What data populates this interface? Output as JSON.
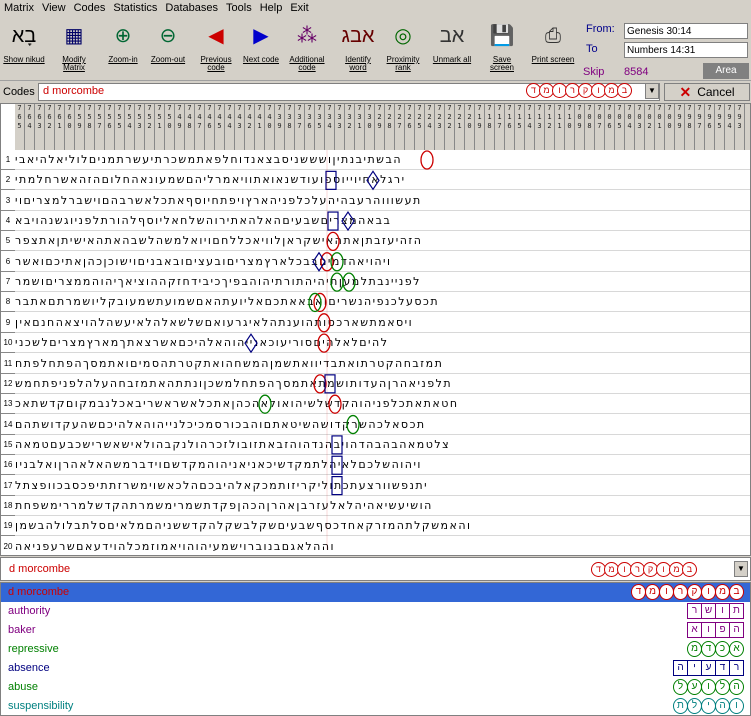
{
  "menu": [
    "Matrix",
    "View",
    "Codes",
    "Statistics",
    "Databases",
    "Tools",
    "Help",
    "Exit"
  ],
  "toolbar": [
    {
      "label": "Show nikud",
      "icon": "nikud-icon"
    },
    {
      "label": "Modify Matrix",
      "icon": "modify-matrix-icon"
    },
    {
      "label": "Zoom-in",
      "icon": "zoom-in-icon"
    },
    {
      "label": "Zoom-out",
      "icon": "zoom-out-icon"
    },
    {
      "label": "Previous code",
      "icon": "previous-code-icon"
    },
    {
      "label": "Next code",
      "icon": "next-code-icon"
    },
    {
      "label": "Additional code",
      "icon": "additional-code-icon"
    },
    {
      "label": "Identify word",
      "icon": "identify-word-icon"
    },
    {
      "label": "Proximity rank",
      "icon": "proximity-rank-icon"
    },
    {
      "label": "Unmark all",
      "icon": "unmark-all-icon"
    },
    {
      "label": "Save screen",
      "icon": "save-screen-icon"
    },
    {
      "label": "Print screen",
      "icon": "print-screen-icon"
    }
  ],
  "range": {
    "from_label": "From:",
    "from_value": "Genesis 30:14",
    "to_label": "To",
    "to_value": "Numbers 14:31"
  },
  "skip": {
    "label": "Skip",
    "value": "8584"
  },
  "area_label": "Area",
  "codes": {
    "label": "Codes :",
    "value": "d morcombe",
    "hebrew": [
      "ד",
      "מ",
      "ו",
      "ר",
      "ק",
      "ו",
      "מ",
      "ב"
    ]
  },
  "cancel_label": "Cancel",
  "column_numbers": [
    "7",
    "7",
    "7",
    "7",
    "7",
    "7",
    "7",
    "7",
    "7",
    "7",
    "7",
    "7",
    "7",
    "7",
    "7",
    "7",
    "7",
    "7",
    "7",
    "7",
    "7",
    "7",
    "7",
    "7",
    "7",
    "7",
    "7",
    "7",
    "7",
    "7",
    "7",
    "7",
    "7",
    "7",
    "7",
    "7",
    "7",
    "7",
    "7",
    "7",
    "7",
    "7",
    "7",
    "7",
    "7",
    "7",
    "7",
    "7",
    "7",
    "7",
    "7",
    "7",
    "7",
    "7",
    "7",
    "7",
    "7",
    "7",
    "7",
    "7",
    "7",
    "7",
    "7",
    "7",
    "7",
    "7",
    "7",
    "7",
    "7",
    "7",
    "7",
    "7",
    "7"
  ],
  "column_digits2": [
    "6",
    "6",
    "6",
    "6",
    "6",
    "6",
    "5",
    "5",
    "5",
    "5",
    "5",
    "5",
    "5",
    "5",
    "5",
    "5",
    "4",
    "4",
    "4",
    "4",
    "4",
    "4",
    "4",
    "4",
    "4",
    "4",
    "3",
    "3",
    "3",
    "3",
    "3",
    "3",
    "3",
    "3",
    "3",
    "3",
    "2",
    "2",
    "2",
    "2",
    "2",
    "2",
    "2",
    "2",
    "2",
    "2",
    "1",
    "1",
    "1",
    "1",
    "1",
    "1",
    "1",
    "1",
    "1",
    "1",
    "0",
    "0",
    "0",
    "0",
    "0",
    "0",
    "0",
    "0",
    "0",
    "0",
    "9",
    "9",
    "9",
    "9",
    "9",
    "9",
    "9"
  ],
  "column_digits3": [
    "5",
    "4",
    "3",
    "2",
    "1",
    "0",
    "9",
    "8",
    "7",
    "6",
    "5",
    "4",
    "3",
    "2",
    "1",
    "0",
    "9",
    "8",
    "7",
    "6",
    "5",
    "4",
    "3",
    "2",
    "1",
    "0",
    "9",
    "8",
    "7",
    "6",
    "5",
    "4",
    "3",
    "2",
    "1",
    "0",
    "9",
    "8",
    "7",
    "6",
    "5",
    "4",
    "3",
    "2",
    "1",
    "0",
    "9",
    "8",
    "7",
    "6",
    "5",
    "4",
    "3",
    "2",
    "1",
    "0",
    "9",
    "8",
    "7",
    "6",
    "5",
    "4",
    "3",
    "2",
    "1",
    "0",
    "9",
    "8",
    "7",
    "6",
    "5",
    "4",
    "3"
  ],
  "row_numbers": [
    "1",
    "2",
    "3",
    "4",
    "5",
    "6",
    "7",
    "8",
    "9",
    "10",
    "11",
    "12",
    "13",
    "14",
    "15",
    "16",
    "17",
    "18",
    "19",
    "20"
  ],
  "grid_rows": [
    "הבשתיבנתיןושששניסבצאנדוחלפאתמשכרתיעשרתמניםלוליאלהיאבי",
    "ירגלאחיוייוספועודשנאואתוויאמרליהםשמעונאהחלוםהזהאשרחלמתי",
    "תעשוווהרעבהיהעלכלפניהארץויפתחיוסףאתכלאשרבהםוישברלמצריםוי",
    "בבאהמצריםשבעיםהאלהאתירוהשלחאליוסףלהורתלפניוגשנהויבא",
    "הזהיעזבתןאתהאישקראןלוויאכללחםויואלמשהלשבהאתהאישיתןאתצפר",
    "ויהויאהדמיםבבכלארץמצריםובעציםובאבניםוישוכןכהןאתיכםואשר",
    "לפניינבתלמעןתיהיהתורתיהוהבפיךכיבידחזקההוציאךיהוהממצריםושמר",
    "תכסעלכנפיהנשריםואבאאתכםאליועתהאםשמועתשמעובקליושמרתםאתבר",
    "ויסאמתשארכסותהוענתהלאיגרעואםשלשאלהלאיעשהלהויצאהחנםאין",
    "להיםלאלהיםסוריעוכאנייהוהאלהיכםאשרצאתךמארץמצריםלשכני",
    "תמזבחהקטרתואתבדיוואתשמןהמשחהואתקטרתהסמיםואתמסךהפתחלפתח",
    "תלפניאהרןהעדותושמתאתמסךהפתחלמשכןונתתהאתמזבחהעלהלפניפתחמש",
    "חטאתאתכלפניהוהקדשלשיהואולאהכהןאתכלאשראשריבאכלנבמקוםקדשתאכ",
    "תכסאלכהשרקדושהשיטאתםוהבכורסמכיכלנייהוהאלהיכםשהעקדושתהם",
    "צלטמאהבהבהדהויבהנדהוהזבאתזובולזכרהולנקבהולאישאשרישכבעםטמאה",
    "ויהוהשלכםלאיהלתמקדשיכאניאניהוהמקדשםוידברמשהאלאהרןואלבניו",
    "יתנפשוורצעתכתוליקריזותמכקאלהיבכםהלכאשוימשרזתתיפכסבכוופצתל",
    "הושיעשיאהיהלאלעזרבןאהרןהכהןפקדתשמרימשמרתהקדשלמררימשפחת",
    "והאמשקלתהמזרקאחדכסףשבעיםשקלבשקלהקדששניהםמלאיםסלתבלולהבשמן",
    "וההלאגםבנוברוישמעיהוהויאמוזמכלהוידעאםשרעפניאה"
  ],
  "selected_text": "d morcombe",
  "list": [
    {
      "label": "d morcombe",
      "color": "#cc0000",
      "hebrew": [
        "ד",
        "מ",
        "ו",
        "ר",
        "ק",
        "ו",
        "מ",
        "ב"
      ],
      "border": "#cc0000",
      "round": true,
      "selected": true
    },
    {
      "label": "authority",
      "color": "#800080",
      "hebrew": [
        "ר",
        "ש",
        "ו",
        "ת"
      ],
      "border": "#800080",
      "round": false
    },
    {
      "label": "baker",
      "color": "#800080",
      "hebrew": [
        "א",
        "ו",
        "פ",
        "ה"
      ],
      "border": "#800080",
      "round": false
    },
    {
      "label": "repressive",
      "color": "#008000",
      "hebrew": [
        "מ",
        "ד",
        "כ",
        "א"
      ],
      "border": "#008000",
      "round": true
    },
    {
      "label": "absence",
      "color": "#000080",
      "hebrew": [
        "ה",
        "י",
        "ע",
        "ד",
        "ר"
      ],
      "border": "#000080",
      "round": false
    },
    {
      "label": "abuse",
      "color": "#008000",
      "hebrew": [
        "ל",
        "ע",
        "ו",
        "ל",
        "ה"
      ],
      "border": "#008000",
      "round": true
    },
    {
      "label": "suspensibility",
      "color": "#008080",
      "hebrew": [
        "ת",
        "ל",
        "י",
        "ה",
        "ו"
      ],
      "border": "#008080",
      "round": true
    }
  ]
}
